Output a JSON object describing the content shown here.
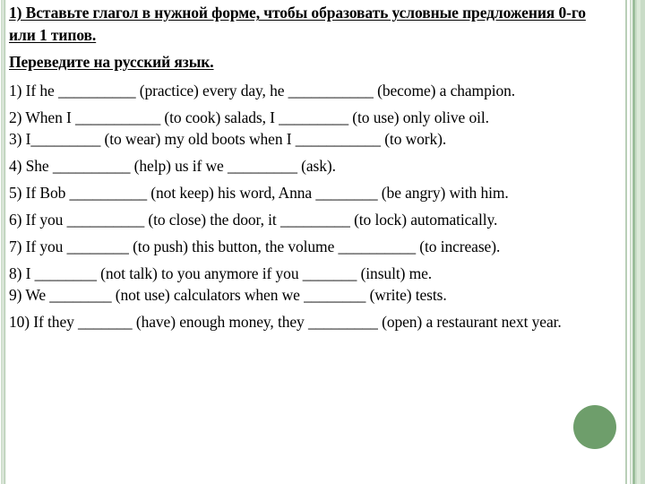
{
  "slide": {
    "headings": [
      {
        "id": "task-instruction",
        "text": "1) Вставьте глагол в нужной форме, чтобы образовать условные предложения 0-го или 1 типов."
      },
      {
        "id": "translate-instruction",
        "text": "Переведите на русский язык."
      }
    ],
    "exercises": [
      {
        "number": "1)",
        "text": "1) If he __________ (practice) every day, he ___________ (become) a champion."
      },
      {
        "number": "2)",
        "text": "2) When I ___________ (to cook) salads, I _________ (to use) only olive oil."
      },
      {
        "number": "3)",
        "text": "3) I_________ (to wear) my old boots when I ___________ (to work)."
      },
      {
        "number": "4)",
        "text": "4) She __________ (help) us if we _________ (ask)."
      },
      {
        "number": "5)",
        "text": "5) If Bob __________ (not keep) his word, Anna ________ (be angry) with him."
      },
      {
        "number": "6)",
        "text": "6) If you __________ (to close) the door, it _________ (to lock) automatically."
      },
      {
        "number": "7)",
        "text": "7) If you ________ (to push) this button, the volume __________ (to increase)."
      },
      {
        "number": "8)",
        "text": "8) I ________ (not talk) to you anymore if you _______ (insult) me."
      },
      {
        "number": "9)",
        "text": "9) We ________ (not use) calculators when we ________ (write) tests."
      },
      {
        "number": "10)",
        "text": "10) If they _______ (have) enough money, they _________ (open) a restaurant next year."
      }
    ],
    "decorations": {
      "ellipse_color": "#6e9e6b",
      "border_accent_color": "#9cbe9b",
      "background_color": "#ffffff"
    }
  }
}
